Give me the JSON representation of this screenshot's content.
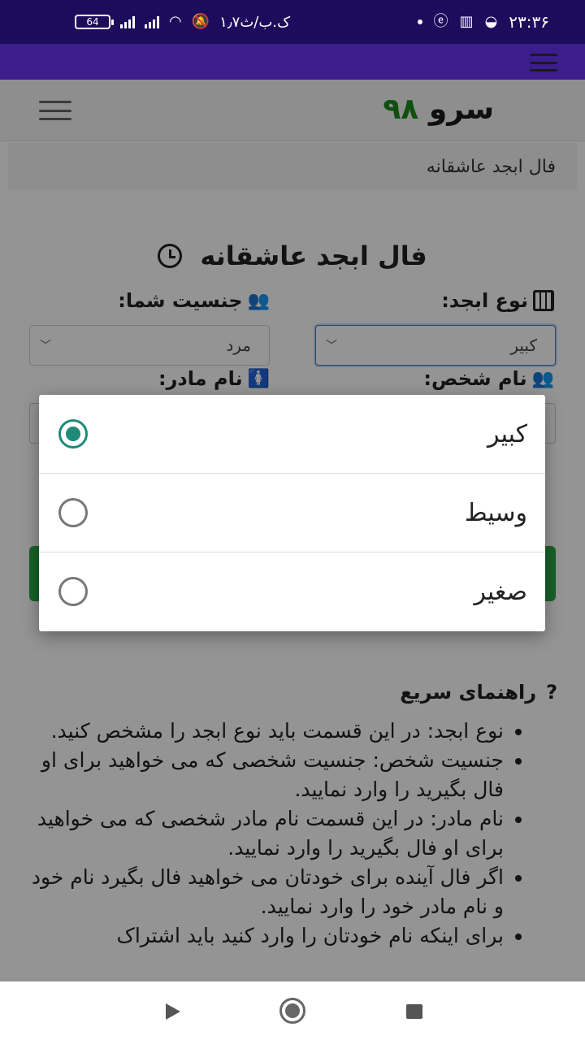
{
  "status_bar": {
    "battery": "64",
    "network_speed": "۱٫۷ک.ب/ث",
    "time": "۲۳:۳۶"
  },
  "site": {
    "logo_word": "سرو",
    "logo_number": "۹۸"
  },
  "breadcrumb": "فال ابجد عاشقانه",
  "page_title": "فال ابجد عاشقانه",
  "form": {
    "type_label": "نوع ابجد:",
    "type_value": "کبیر",
    "gender_label": "جنسیت شما:",
    "gender_value": "مرد",
    "name_label": "نام شخص:",
    "mother_label": "نام مادر:"
  },
  "dialog": {
    "options": [
      "کبیر",
      "وسیط",
      "صغیر"
    ],
    "selected_index": 0
  },
  "help": {
    "title": "راهنمای سریع",
    "items": [
      "نوع ابجد: در این قسمت باید نوع ابجد را مشخص کنید.",
      "جنسیت شخص: جنسیت شخصی که می خواهید برای او فال بگیرید را وارد نمایید.",
      "نام مادر: در این قسمت نام مادر شخصی که می خواهید برای او فال بگیرید را وارد نمایید.",
      "اگر فال آینده برای خودتان می خواهید فال بگیرد نام خود و نام مادر خود را وارد نمایید.",
      "برای اینکه نام خودتان را وارد کنید باید اشتراک"
    ]
  },
  "colors": {
    "status_bar": "#1d0c5c",
    "app_bar": "#3b1d8c",
    "radio_selected": "#1f8a78",
    "logo_number": "#1a8a1a"
  }
}
